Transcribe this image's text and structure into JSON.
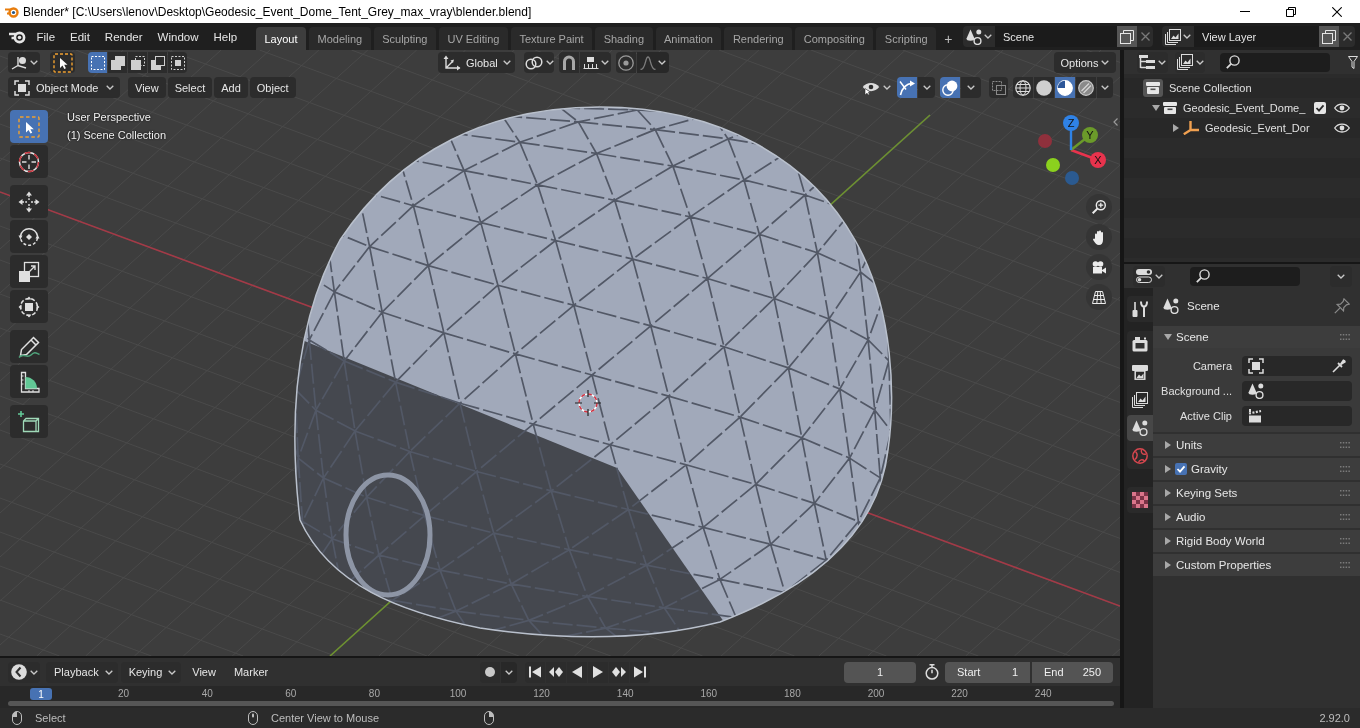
{
  "window": {
    "title": "Blender* [C:\\Users\\lenov\\Desktop\\Geodesic_Event_Dome_Tent_Grey_max_vray\\blender.blend]"
  },
  "top_bar": {
    "menus": [
      "File",
      "Edit",
      "Render",
      "Window",
      "Help"
    ],
    "workspace_tabs": [
      {
        "label": "Layout",
        "selected": true
      },
      {
        "label": "Modeling",
        "selected": false
      },
      {
        "label": "Sculpting",
        "selected": false
      },
      {
        "label": "UV Editing",
        "selected": false
      },
      {
        "label": "Texture Paint",
        "selected": false
      },
      {
        "label": "Shading",
        "selected": false
      },
      {
        "label": "Animation",
        "selected": false
      },
      {
        "label": "Rendering",
        "selected": false
      },
      {
        "label": "Compositing",
        "selected": false
      },
      {
        "label": "Scripting",
        "selected": false
      }
    ],
    "add_workspace": "+",
    "scene": "Scene",
    "view_layer": "View Layer"
  },
  "viewport": {
    "tool_header": {
      "select_modes": [
        {
          "kind": "set",
          "selected": true
        },
        {
          "kind": "extend",
          "selected": false
        },
        {
          "kind": "subtract",
          "selected": false
        },
        {
          "kind": "invert",
          "selected": false
        },
        {
          "kind": "intersect",
          "selected": false
        }
      ],
      "orientation": "Global",
      "options": "Options"
    },
    "header": {
      "mode": "Object Mode",
      "menus": [
        "View",
        "Select",
        "Add",
        "Object"
      ],
      "gizmos": true,
      "overlays": true,
      "xray": false,
      "shading": [
        {
          "kind": "wireframe",
          "selected": false
        },
        {
          "kind": "solid",
          "selected": false
        },
        {
          "kind": "material",
          "selected": true
        },
        {
          "kind": "rendered",
          "selected": false
        }
      ]
    },
    "tool_groups": [
      [
        {
          "kind": "select_box",
          "selected": true
        },
        {
          "kind": "cursor",
          "selected": false
        }
      ],
      [
        {
          "kind": "move",
          "selected": false
        },
        {
          "kind": "rotate",
          "selected": false
        },
        {
          "kind": "scale",
          "selected": false
        },
        {
          "kind": "transform",
          "selected": false
        }
      ],
      [
        {
          "kind": "annotate",
          "selected": false
        },
        {
          "kind": "measure",
          "selected": false
        }
      ],
      [
        {
          "kind": "add_cube",
          "selected": false
        }
      ]
    ],
    "overlay_text": [
      "User Perspective",
      "(1) Scene Collection"
    ],
    "gizmo_axes": [
      {
        "kind": "x",
        "label": "X"
      },
      {
        "kind": "y",
        "label": "Y"
      },
      {
        "kind": "z",
        "label": "Z"
      }
    ]
  },
  "outliner": {
    "tree": [
      {
        "kind": "scene_collection",
        "label": "Scene Collection",
        "children": [
          {
            "kind": "collection",
            "label": "Geodesic_Event_Dome_",
            "expanded": true,
            "checked": true,
            "visible": true,
            "children": [
              {
                "kind": "object",
                "label": "Geodesic_Event_Dor",
                "expanded": false,
                "visible": true
              }
            ]
          }
        ]
      }
    ]
  },
  "properties": {
    "tab_groups": [
      [
        {
          "kind": "tool",
          "selected": false
        }
      ],
      [
        {
          "kind": "render",
          "selected": false
        },
        {
          "kind": "output",
          "selected": false
        },
        {
          "kind": "view_layer",
          "selected": false
        },
        {
          "kind": "scene",
          "selected": true
        },
        {
          "kind": "world",
          "selected": false
        }
      ],
      [
        {
          "kind": "texture",
          "selected": false
        }
      ]
    ],
    "context": "Scene",
    "panels": [
      {
        "kind": "plain",
        "label": "Scene",
        "expanded": true,
        "fields": [
          {
            "kind": "object",
            "label": "Camera"
          },
          {
            "kind": "scene",
            "label": "Background ..."
          },
          {
            "kind": "clip",
            "label": "Active Clip"
          }
        ]
      },
      {
        "kind": "plain",
        "label": "Units",
        "expanded": false
      },
      {
        "kind": "toggle",
        "label": "Gravity",
        "expanded": false,
        "checked": true
      },
      {
        "kind": "plain",
        "label": "Keying Sets",
        "expanded": false
      },
      {
        "kind": "plain",
        "label": "Audio",
        "expanded": false
      },
      {
        "kind": "plain",
        "label": "Rigid Body World",
        "expanded": false
      },
      {
        "kind": "plain",
        "label": "Custom Properties",
        "expanded": false
      }
    ]
  },
  "timeline": {
    "menus": [
      {
        "kind": "dropdown",
        "label": "Playback"
      },
      {
        "kind": "dropdown",
        "label": "Keying"
      },
      {
        "kind": "menu",
        "label": "View"
      },
      {
        "kind": "menu",
        "label": "Marker"
      }
    ],
    "current_frame": "1",
    "start_label": "Start",
    "start": "1",
    "end_label": "End",
    "end": "250",
    "playhead": "1",
    "ruler": [
      "20",
      "40",
      "60",
      "80",
      "100",
      "120",
      "140",
      "160",
      "180",
      "200",
      "220",
      "240"
    ]
  },
  "status_bar": {
    "hints": [
      "Select",
      "Center View to Mouse"
    ],
    "version": "2.92.0"
  }
}
